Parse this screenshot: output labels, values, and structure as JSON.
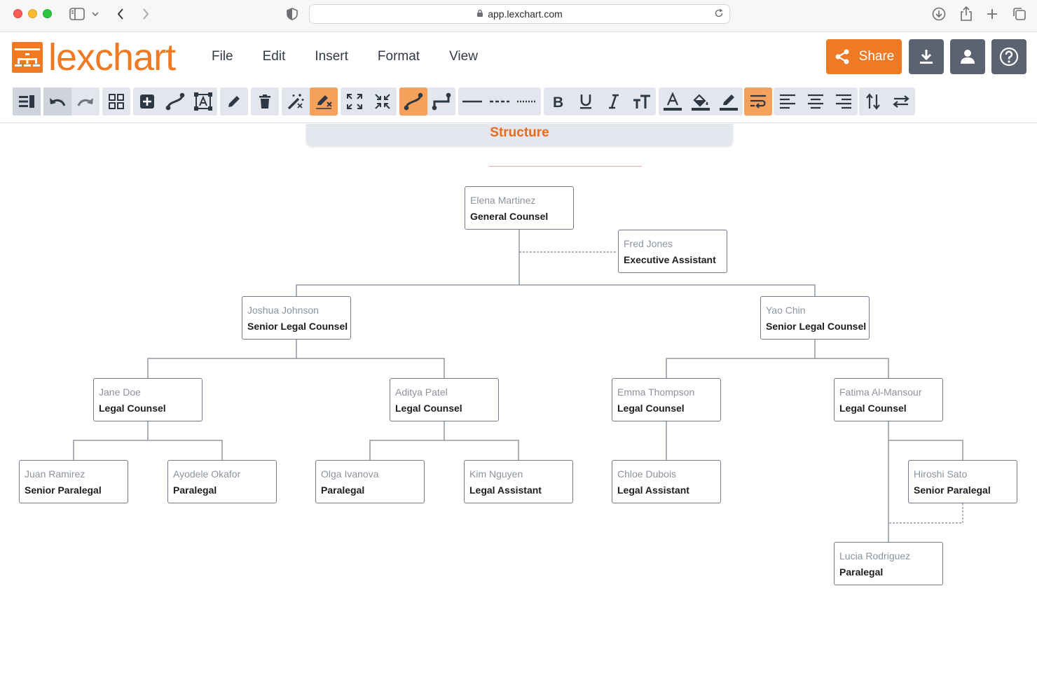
{
  "browser": {
    "url": "app.lexchart.com"
  },
  "app": {
    "logo_text": "lexchart",
    "menu": [
      "File",
      "Edit",
      "Insert",
      "Format",
      "View"
    ],
    "share_label": "Share",
    "accent_color": "#f07a24"
  },
  "toolbar": {
    "icons": [
      "outline-panel-icon",
      "undo-icon",
      "redo-icon",
      "grid-icon",
      "add-box-icon",
      "connector-icon",
      "text-box-icon",
      "pen-icon",
      "trash-icon",
      "magic-wand-icon",
      "auto-format-icon",
      "expand-icon",
      "collapse-icon",
      "curved-line-icon",
      "elbow-line-icon",
      "solid-line-icon",
      "dashed-line-icon",
      "dotted-line-icon",
      "bold-icon",
      "underline-icon",
      "italic-icon",
      "text-size-icon",
      "font-color-icon",
      "fill-color-icon",
      "line-color-icon",
      "wrap-text-icon",
      "align-left-icon",
      "align-center-icon",
      "align-right-icon",
      "swap-vertical-icon",
      "swap-horizontal-icon"
    ]
  },
  "section": {
    "title": "Structure"
  },
  "nodes": [
    {
      "id": "elena",
      "name": "Elena Martinez",
      "role": "General Counsel"
    },
    {
      "id": "fred",
      "name": "Fred Jones",
      "role": "Executive Assistant"
    },
    {
      "id": "joshua",
      "name": "Joshua Johnson",
      "role": "Senior Legal Counsel"
    },
    {
      "id": "yao",
      "name": "Yao Chin",
      "role": "Senior Legal Counsel"
    },
    {
      "id": "jane",
      "name": "Jane Doe",
      "role": "Legal Counsel"
    },
    {
      "id": "aditya",
      "name": "Aditya Patel",
      "role": "Legal Counsel"
    },
    {
      "id": "emma",
      "name": "Emma Thompson",
      "role": "Legal Counsel"
    },
    {
      "id": "fatima",
      "name": "Fatima Al-Mansour",
      "role": "Legal Counsel"
    },
    {
      "id": "juan",
      "name": "Juan Ramirez",
      "role": "Senior Paralegal"
    },
    {
      "id": "ayodele",
      "name": "Ayodele Okafor",
      "role": "Paralegal"
    },
    {
      "id": "olga",
      "name": "Olga Ivanova",
      "role": "Paralegal"
    },
    {
      "id": "kim",
      "name": "Kim Nguyen",
      "role": "Legal Assistant"
    },
    {
      "id": "chloe",
      "name": "Chloe Dubois",
      "role": "Legal Assistant"
    },
    {
      "id": "hiroshi",
      "name": "Hiroshi Sato",
      "role": "Senior Paralegal"
    },
    {
      "id": "lucia",
      "name": "Lucia Rodriguez",
      "role": "Paralegal"
    }
  ]
}
